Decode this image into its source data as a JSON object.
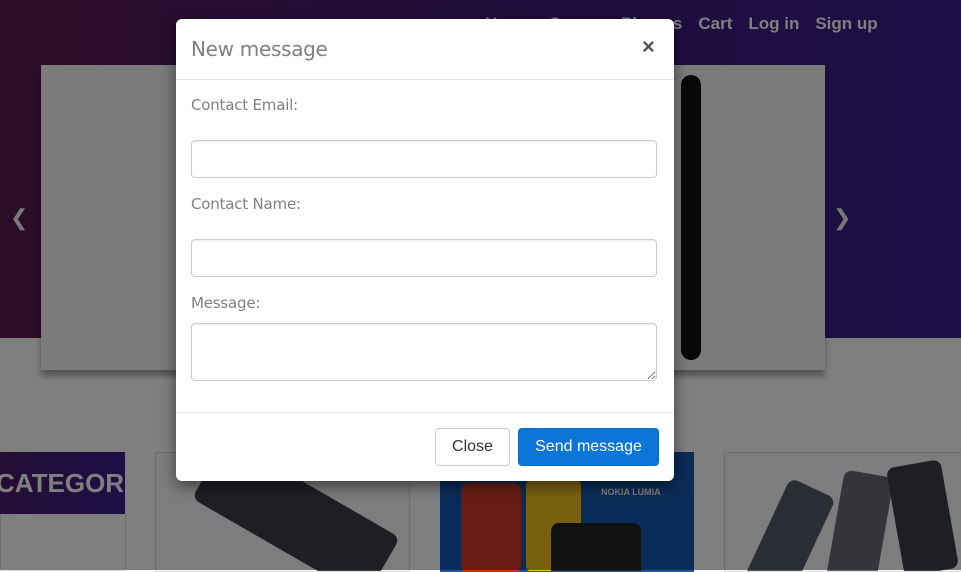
{
  "background_page": {
    "nav": {
      "items": [
        "Home",
        "Games",
        "Phones",
        "Cart",
        "Log in",
        "Sign up"
      ]
    },
    "carousel": {
      "prev_icon": "chevron-left-icon",
      "next_icon": "chevron-right-icon"
    },
    "categories_heading": "CATEGORIES",
    "product_brand_text": "NOKIA LUMIA"
  },
  "modal": {
    "title": "New message",
    "close_icon": "close-icon",
    "fields": {
      "email_label": "Contact Email:",
      "email_value": "",
      "name_label": "Contact Name:",
      "name_value": "",
      "message_label": "Message:",
      "message_value": ""
    },
    "footer": {
      "close_label": "Close",
      "send_label": "Send message"
    }
  },
  "colors": {
    "primary_button": "#0b75d8",
    "hero_gradient_start": "#5a1a4f",
    "hero_gradient_end": "#3a1f8c"
  }
}
